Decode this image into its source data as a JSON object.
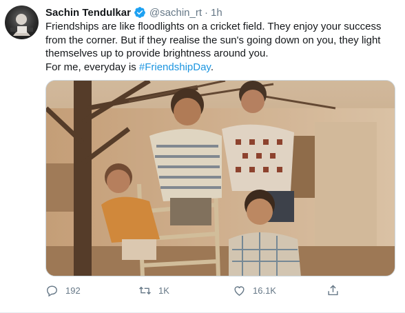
{
  "author": {
    "name": "Sachin Tendulkar",
    "handle": "@sachin_rt",
    "separator": "·",
    "time": "1h",
    "verified": true
  },
  "tweet": {
    "line1": "Friendships are like floodlights on a cricket field. They enjoy your success",
    "line2": "from the corner. But if they realise the sun's going down on you, they light",
    "line3": "themselves up to provide brightness around you.",
    "line4_prefix": "For me, everyday is ",
    "hashtag": "#FriendshipDay",
    "line4_suffix": "."
  },
  "actions": {
    "reply_count": "192",
    "retweet_count": "1K",
    "like_count": "16.1K"
  },
  "colors": {
    "link": "#1b95e0",
    "muted": "#657786",
    "verified_badge": "#1da1f2"
  },
  "icons": [
    "reply-icon",
    "retweet-icon",
    "like-icon",
    "share-icon",
    "verified-badge-icon"
  ]
}
